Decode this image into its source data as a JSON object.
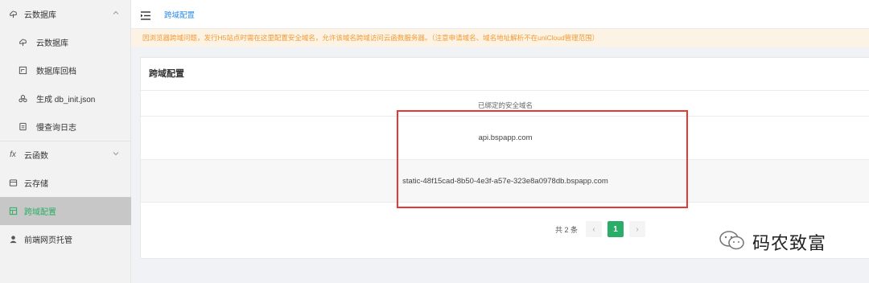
{
  "sidebar": {
    "items": [
      {
        "label": "云数据库",
        "icon": "cloud-db-icon"
      },
      {
        "label": "云数据库",
        "icon": "cloud-db-icon"
      },
      {
        "label": "数据库回档",
        "icon": "rollback-icon"
      },
      {
        "label": "生成 db_init.json",
        "icon": "generate-icon"
      },
      {
        "label": "慢查询日志",
        "icon": "log-icon"
      },
      {
        "label": "云函数",
        "icon": "function-icon"
      },
      {
        "label": "云存储",
        "icon": "storage-icon"
      },
      {
        "label": "跨域配置",
        "icon": "cors-icon"
      },
      {
        "label": "前端网页托管",
        "icon": "hosting-icon"
      }
    ]
  },
  "header": {
    "breadcrumb": "跨域配置"
  },
  "notice": "因浏览器跨域问题，发行H5站点时需在这里配置安全域名，允许该域名跨域访问云函数服务器。（注意申请域名、域名地址解析不在uniCloud管理范围）",
  "card": {
    "title": "跨域配置",
    "column_header": "已绑定的安全域名",
    "rows": [
      "api.bspapp.com",
      "static-48f15cad-8b50-4e3f-a57e-323e8a0978db.bspapp.com"
    ]
  },
  "pagination": {
    "total": "共 2 条",
    "prev": "‹",
    "current": "1",
    "next": "›"
  },
  "watermark": {
    "text": "码农致富",
    "icon": "wechat-icon"
  },
  "colors": {
    "accent": "#2aae67",
    "link": "#2e8ce6",
    "notice_text": "#f29a33",
    "highlight_box": "#e53935"
  }
}
